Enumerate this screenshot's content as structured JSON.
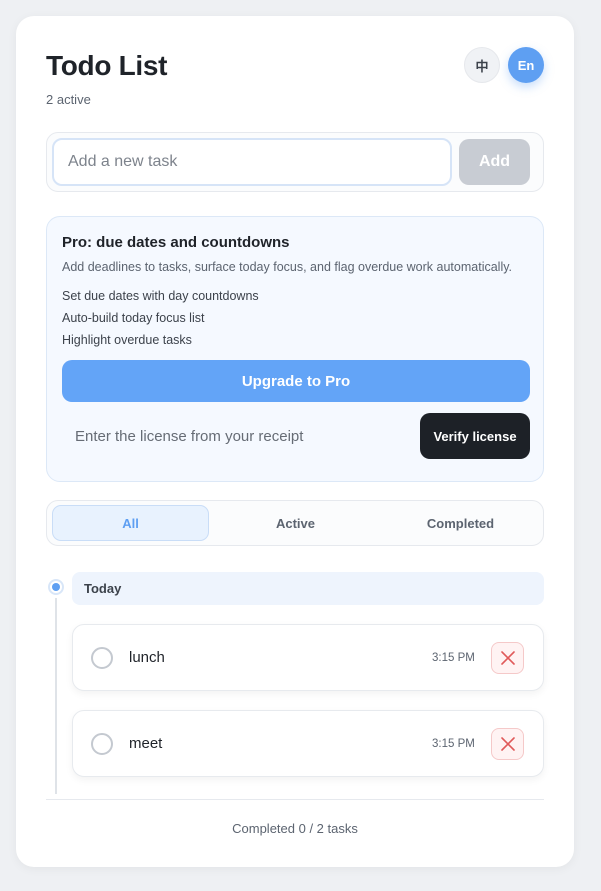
{
  "header": {
    "title": "Todo List",
    "active_count": "2 active",
    "lang_zh": "中",
    "lang_en": "En"
  },
  "add_task": {
    "placeholder": "Add a new task",
    "button": "Add"
  },
  "pro": {
    "title": "Pro: due dates and countdowns",
    "description": "Add deadlines to tasks, surface today focus, and flag overdue work automatically.",
    "features": [
      "Set due dates with day countdowns",
      "Auto-build today focus list",
      "Highlight overdue tasks"
    ],
    "upgrade_button": "Upgrade to Pro",
    "license_placeholder": "Enter the license from your receipt",
    "verify_button": "Verify license"
  },
  "filters": [
    {
      "label": "All",
      "selected": true
    },
    {
      "label": "Active",
      "selected": false
    },
    {
      "label": "Completed",
      "selected": false
    }
  ],
  "group": {
    "label": "Today",
    "tasks": [
      {
        "text": "lunch",
        "time": "3:15 PM",
        "done": false
      },
      {
        "text": "meet",
        "time": "3:15 PM",
        "done": false
      }
    ]
  },
  "footer": {
    "summary": "Completed 0 / 2 tasks"
  },
  "colors": {
    "accent": "#5e9ff2",
    "delete": "#e05a5a",
    "dark_button": "#1d2127"
  }
}
